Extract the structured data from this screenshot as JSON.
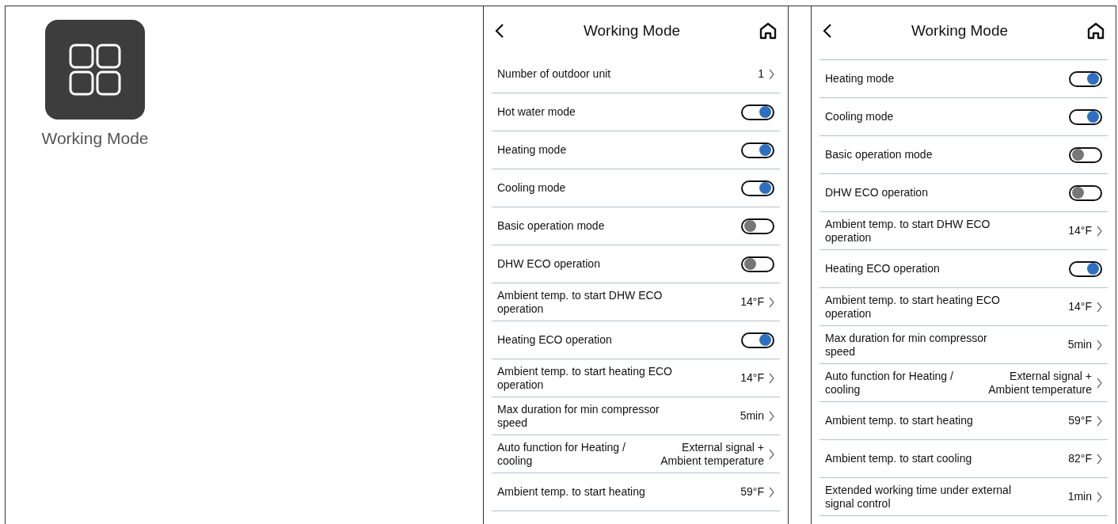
{
  "app_tile": {
    "label": "Working Mode"
  },
  "screens": [
    {
      "title": "Working Mode",
      "scrolled": false,
      "rows": [
        {
          "kind": "value",
          "label": "Number of outdoor unit",
          "value": "1"
        },
        {
          "kind": "toggle",
          "label": "Hot water mode",
          "on": true
        },
        {
          "kind": "toggle",
          "label": "Heating mode",
          "on": true
        },
        {
          "kind": "toggle",
          "label": "Cooling mode",
          "on": true
        },
        {
          "kind": "toggle",
          "label": "Basic operation mode",
          "on": false
        },
        {
          "kind": "toggle",
          "label": "DHW ECO operation",
          "on": false
        },
        {
          "kind": "value",
          "label": "Ambient temp. to start DHW ECO operation",
          "value": "14°F"
        },
        {
          "kind": "toggle",
          "label": "Heating ECO operation",
          "on": true
        },
        {
          "kind": "value",
          "label": "Ambient temp. to start heating ECO operation",
          "value": "14°F"
        },
        {
          "kind": "value",
          "label": "Max duration for min compressor speed",
          "value": "5min"
        },
        {
          "kind": "value",
          "label": "Auto function for Heating / cooling",
          "value": "External signal + Ambient temperature"
        },
        {
          "kind": "value",
          "label": "Ambient temp. to start heating",
          "value": "59°F"
        }
      ]
    },
    {
      "title": "Working Mode",
      "scrolled": true,
      "rows": [
        {
          "kind": "toggle",
          "label": "Heating mode",
          "on": true
        },
        {
          "kind": "toggle",
          "label": "Cooling mode",
          "on": true
        },
        {
          "kind": "toggle",
          "label": "Basic operation mode",
          "on": false
        },
        {
          "kind": "toggle",
          "label": "DHW ECO operation",
          "on": false
        },
        {
          "kind": "value",
          "label": "Ambient temp. to start DHW ECO operation",
          "value": "14°F"
        },
        {
          "kind": "toggle",
          "label": "Heating ECO operation",
          "on": true
        },
        {
          "kind": "value",
          "label": "Ambient temp. to start heating ECO operation",
          "value": "14°F"
        },
        {
          "kind": "value",
          "label": "Max duration for min compressor speed",
          "value": "5min"
        },
        {
          "kind": "value",
          "label": "Auto function for Heating / cooling",
          "value": "External signal + Ambient temperature"
        },
        {
          "kind": "value",
          "label": "Ambient temp. to start heating",
          "value": "59°F"
        },
        {
          "kind": "value",
          "label": "Ambient temp. to start cooling",
          "value": "82°F"
        },
        {
          "kind": "value",
          "label": "Extended working time under external signal control",
          "value": "1min"
        }
      ]
    }
  ]
}
